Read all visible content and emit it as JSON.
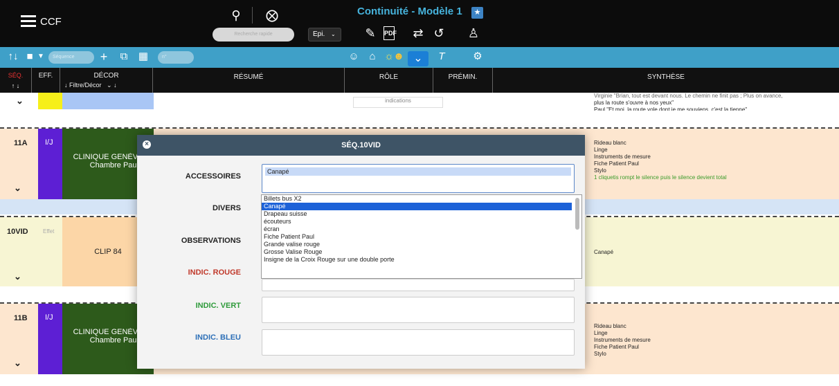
{
  "app": {
    "name": "CCF",
    "title": "Continuité - Modèle 1"
  },
  "topbar": {
    "search_placeholder": "Recherche rapide",
    "episode_select": "Epi."
  },
  "toolbar2": {
    "nav_placeholder": "Séquence",
    "filter_placeholder": "n°"
  },
  "columns": {
    "seq": "SÉQ.",
    "eff": "EFF.",
    "decor": "DÉCOR",
    "decor_filter": "Filtre/Décor",
    "resume": "RÉSUMÉ",
    "role": "RÔLE",
    "premin": "PRÉMIN.",
    "synthese": "SYNTHÈSE"
  },
  "rows": {
    "top": {
      "role_text": "indications",
      "synth": [
        "Virginie \"Brian, tout est devant nous. Le chemin ne finit pas ; Plus on avance,",
        "plus la route s'ouvre à nos yeux\"",
        "Paul \"Et moi, la route vole dont je me souviens, c'est la tienne\""
      ]
    },
    "r11a": {
      "seq": "11A",
      "eff": "I/J",
      "decor_line1": "CLINIQUE GENÈVE",
      "decor_line2": "Chambre Paul",
      "synth": [
        "Rideau blanc",
        "Linge",
        "Instruments de mesure",
        "Fiche Patient Paul",
        "Stylo"
      ],
      "synth_green": "1 cliquetis rompt le silence puis le silence devient total"
    },
    "r10vid": {
      "seq": "10VID",
      "eff": "Effet",
      "decor": "CLIP 84",
      "synth": "Canapé"
    },
    "r11b": {
      "seq": "11B",
      "eff": "I/J",
      "decor_line1": "CLINIQUE GENÈVE",
      "decor_line2": "Chambre Paul",
      "synth": [
        "Rideau blanc",
        "Linge",
        "Instruments de mesure",
        "Fiche Patient Paul",
        "Stylo"
      ]
    }
  },
  "modal": {
    "title": "SÉQ.10VID",
    "labels": {
      "accessoires": "ACCESSOIRES",
      "divers": "DIVERS",
      "observations": "OBSERVATIONS",
      "rouge": "INDIC. ROUGE",
      "vert": "INDIC. VERT",
      "bleu": "INDIC. BLEU"
    },
    "accessoires_value": "Canapé",
    "options": [
      "Billets bus X2",
      "Canapé",
      "Drapeau suisse",
      "écouteurs",
      "écran",
      "Fiche Patient Paul",
      "Grande valise rouge",
      "Grosse Valise Rouge",
      "Insigne de la Croix Rouge sur une double porte"
    ],
    "selected_index": 1
  },
  "colors": {
    "accent_teal": "#3fa0c8",
    "title_blue": "#46b3dc",
    "red": "#c0392b",
    "green": "#2e9a3a",
    "blue": "#2c6fb7"
  }
}
